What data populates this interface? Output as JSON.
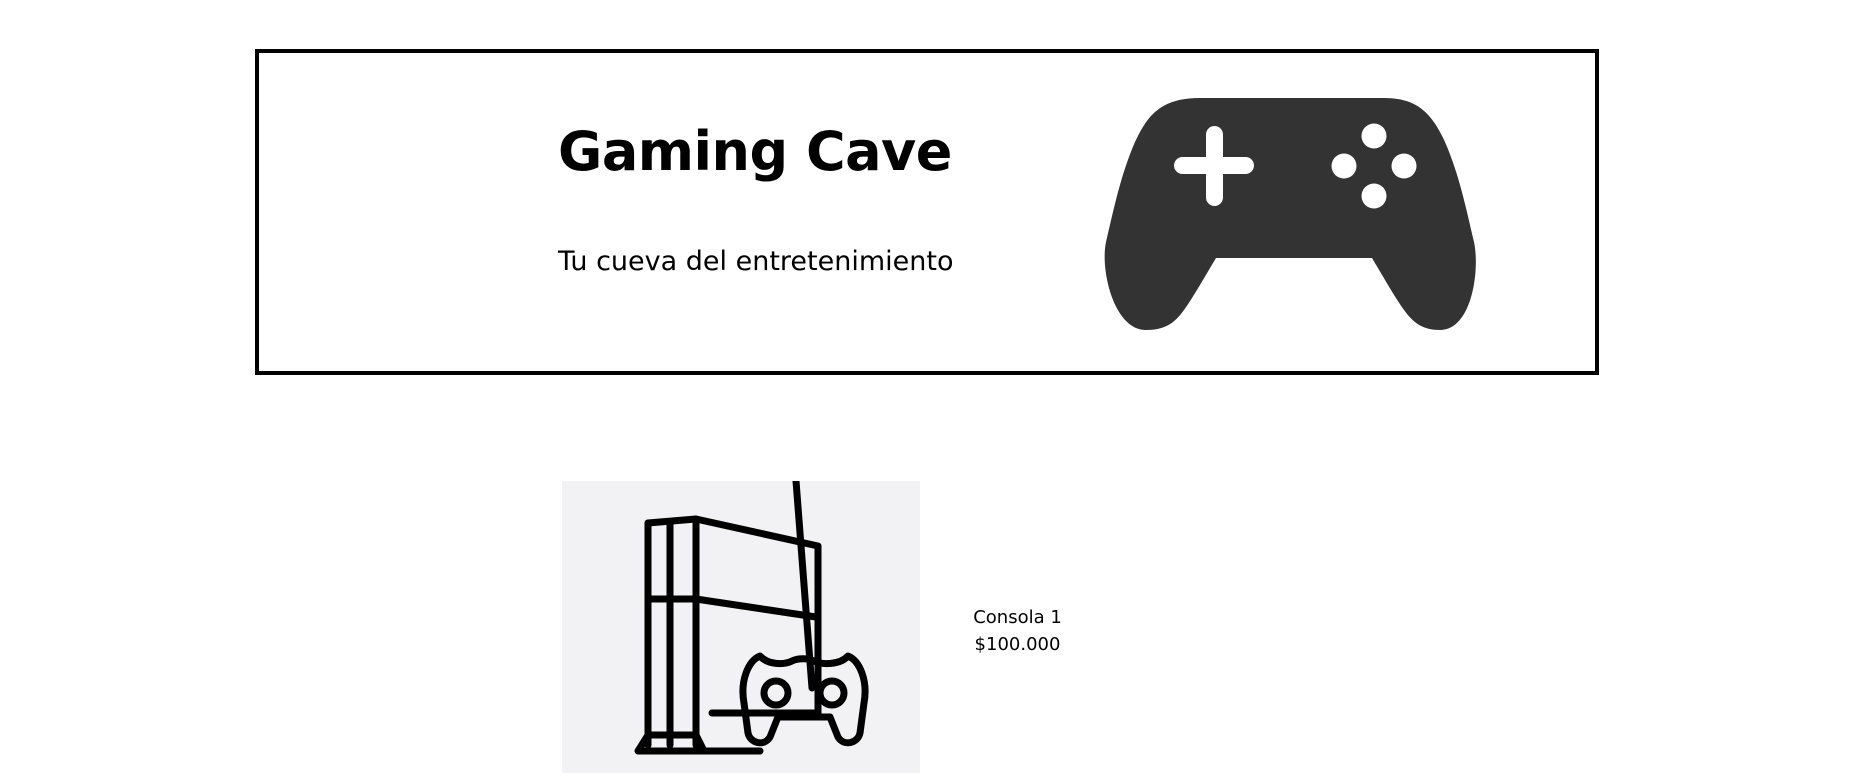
{
  "header": {
    "title": "Gaming Cave",
    "tagline": "Tu cueva del entretenimiento",
    "icon": "gamepad-icon"
  },
  "products": [
    {
      "name": "Consola 1",
      "price": "$100.000",
      "icon": "game-console-icon"
    }
  ],
  "colors": {
    "border": "#000000",
    "icon_fill": "#333333",
    "product_image_bg": "#f2f2f4"
  }
}
